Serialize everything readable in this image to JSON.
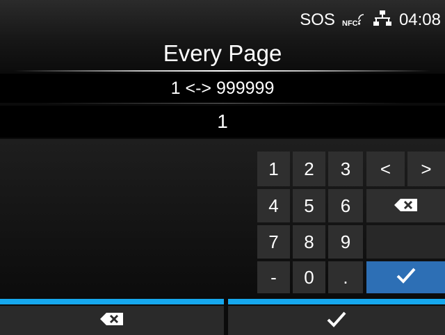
{
  "status_bar": {
    "sos_label": "SOS",
    "nfc_label": "NFC",
    "time": "04:08"
  },
  "title": "Every Page",
  "range_text": "1 <-> 999999",
  "current_value": "1",
  "keypad": {
    "digits": [
      "1",
      "2",
      "3",
      "4",
      "5",
      "6",
      "7",
      "8",
      "9",
      "0"
    ],
    "minus_label": "-",
    "dot_label": ".",
    "left_label": "<",
    "right_label": ">"
  },
  "colors": {
    "accent_blue": "#16a8ee",
    "confirm_key": "#2d6fb5"
  },
  "icons": [
    "nfc-icon",
    "network-icon",
    "backspace-icon",
    "checkmark-icon"
  ]
}
